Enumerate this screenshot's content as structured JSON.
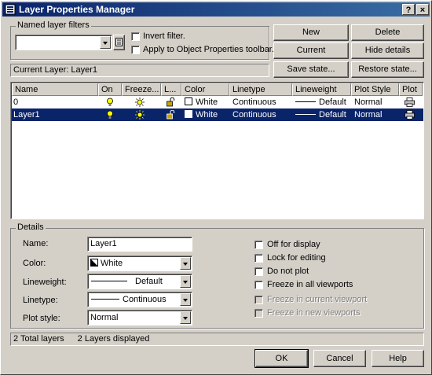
{
  "window": {
    "title": "Layer Properties Manager",
    "help_btn": "?",
    "close_btn": "×"
  },
  "filters": {
    "group_label": "Named layer filters",
    "combo_value": "",
    "invert_label": "Invert filter.",
    "apply_label": "Apply to Object Properties toolbar."
  },
  "buttons": {
    "new": "New",
    "delete": "Delete",
    "current": "Current",
    "hide_details": "Hide details",
    "save_state": "Save state...",
    "restore_state": "Restore state..."
  },
  "current_layer": {
    "label": "Current Layer:",
    "value": "Layer1"
  },
  "table": {
    "headers": [
      "Name",
      "On",
      "Freeze...",
      "L...",
      "Color",
      "Linetype",
      "Lineweight",
      "Plot Style",
      "Plot"
    ],
    "rows": [
      {
        "name": "0",
        "color": "White",
        "linetype": "Continuous",
        "lineweight": "Default",
        "plotstyle": "Normal",
        "selected": false
      },
      {
        "name": "Layer1",
        "color": "White",
        "linetype": "Continuous",
        "lineweight": "Default",
        "plotstyle": "Normal",
        "selected": true
      }
    ]
  },
  "details": {
    "group_label": "Details",
    "name_label": "Name:",
    "name_value": "Layer1",
    "color_label": "Color:",
    "color_value": "White",
    "lineweight_label": "Lineweight:",
    "lineweight_value": "Default",
    "linetype_label": "Linetype:",
    "linetype_value": "Continuous",
    "plotstyle_label": "Plot style:",
    "plotstyle_value": "Normal",
    "checks": [
      {
        "label": "Off for display",
        "enabled": true,
        "checked": false
      },
      {
        "label": "Lock for editing",
        "enabled": true,
        "checked": false
      },
      {
        "label": "Do not plot",
        "enabled": true,
        "checked": false
      },
      {
        "label": "Freeze in all viewports",
        "enabled": true,
        "checked": false
      },
      {
        "label": "Freeze in current viewport",
        "enabled": false,
        "checked": false
      },
      {
        "label": "Freeze in new viewports",
        "enabled": false,
        "checked": false
      }
    ]
  },
  "status": {
    "total": "2 Total layers",
    "displayed": "2 Layers displayed"
  },
  "footer": {
    "ok": "OK",
    "cancel": "Cancel",
    "help": "Help"
  },
  "colors": {
    "title_active": "#0a246a",
    "selection": "#0a246a",
    "dialog_bg": "#d4d0c8"
  },
  "icons": {
    "on": "lightbulb-icon",
    "freeze": "sun-icon",
    "lock": "padlock-icon",
    "plot": "printer-icon"
  }
}
